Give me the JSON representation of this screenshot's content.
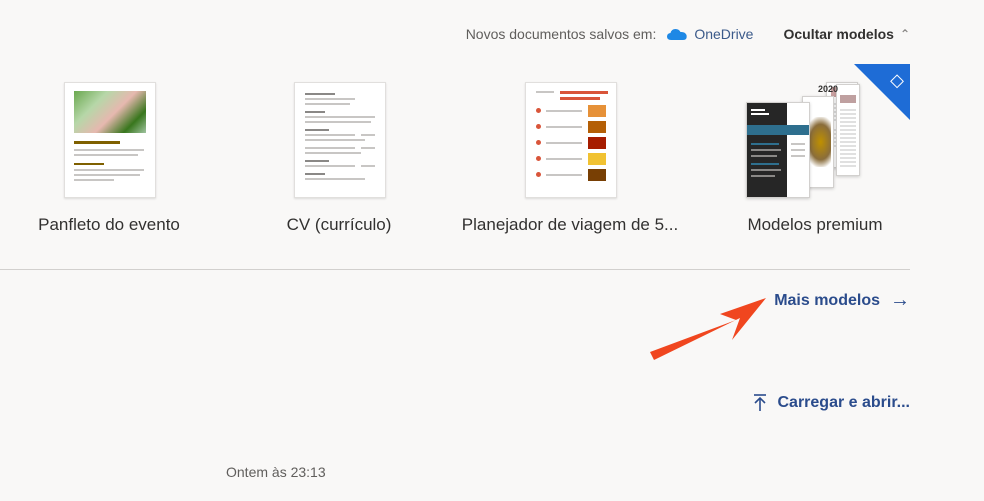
{
  "header": {
    "saved_label": "Novos documentos salvos em:",
    "onedrive_label": "OneDrive",
    "hide_templates_label": "Ocultar modelos"
  },
  "templates": [
    {
      "label": "Panfleto do evento",
      "thumb_title": "[Nome do evento]"
    },
    {
      "label": "CV (currículo)"
    },
    {
      "label": "Planejador de viagem de 5...",
      "thumb_title": "Planejador de viagem de 5 dias"
    },
    {
      "label": "Modelos premium",
      "thumb_year": "2020"
    }
  ],
  "more_templates_label": "Mais modelos",
  "upload_label": "Carregar e abrir...",
  "recent": {
    "timestamp": "Ontem às 23:13"
  },
  "colors": {
    "link": "#2b4c8c",
    "premium_badge": "#1e6cd6",
    "annotation_arrow": "#f0461f",
    "onedrive": "#1e88e5"
  }
}
